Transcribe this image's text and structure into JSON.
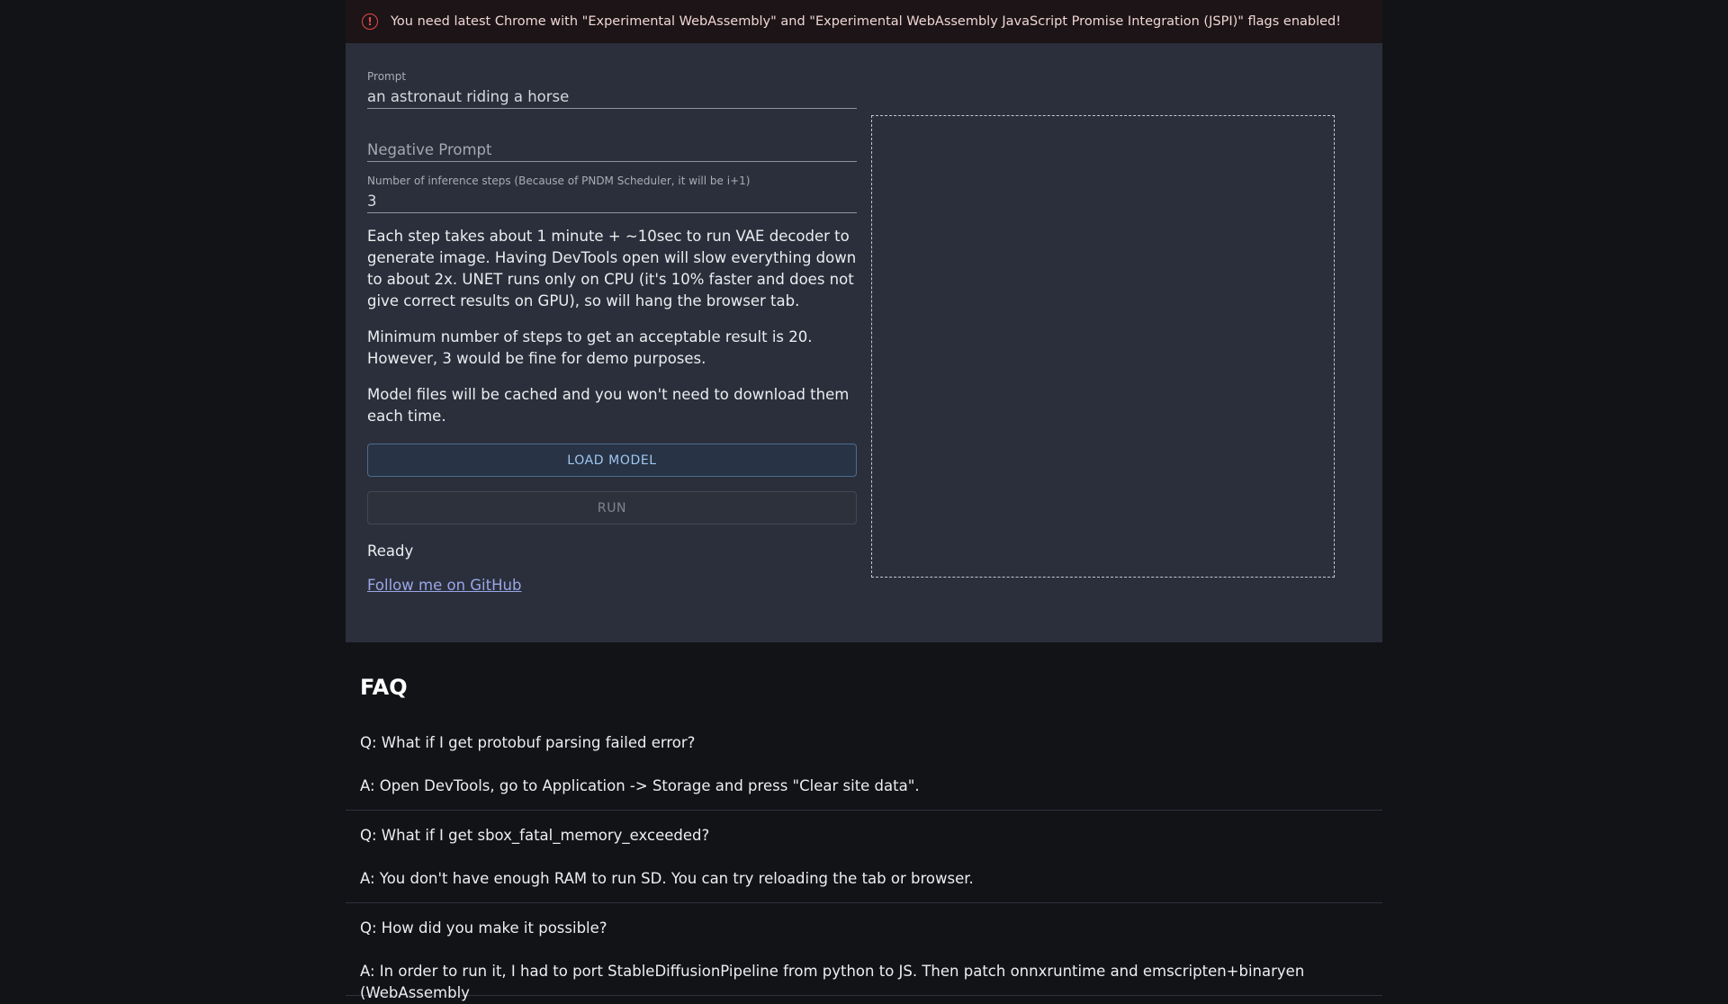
{
  "alert": {
    "icon": "error-icon",
    "text": "You need latest Chrome with \"Experimental WebAssembly\" and \"Experimental WebAssembly JavaScript Promise Integration (JSPI)\" flags enabled!"
  },
  "form": {
    "prompt": {
      "label": "Prompt",
      "value": "an astronaut riding a horse"
    },
    "negative_prompt": {
      "placeholder": "Negative Prompt",
      "value": ""
    },
    "steps": {
      "label": "Number of inference steps (Because of PNDM Scheduler, it will be i+1)",
      "value": "3"
    }
  },
  "descriptions": [
    "Each step takes about 1 minute + ~10sec to run VAE decoder to generate image. Having DevTools open will slow everything down to about 2x. UNET runs only on CPU (it's 10% faster and does not give correct results on GPU), so will hang the browser tab.",
    "Minimum number of steps to get an acceptable result is 20. However, 3 would be fine for demo purposes.",
    "Model files will be cached and you won't need to download them each time."
  ],
  "buttons": {
    "load_model": "LOAD MODEL",
    "run": "RUN"
  },
  "status": "Ready",
  "github_link": "Follow me on GitHub",
  "faq": {
    "title": "FAQ",
    "items": [
      {
        "q": "Q: What if I get protobuf parsing failed error?",
        "a": "A: Open DevTools, go to Application -> Storage and press \"Clear site data\"."
      },
      {
        "q": "Q: What if I get sbox_fatal_memory_exceeded?",
        "a": "A: You don't have enough RAM to run SD. You can try reloading the tab or browser."
      },
      {
        "q": "Q: How did you make it possible?",
        "a": "A: In order to run it, I had to port StableDiffusionPipeline from python to JS. Then patch onnxruntime and emscripten+binaryen (WebAssembly"
      }
    ]
  },
  "colors": {
    "background": "#121317",
    "card": "#2a2f3b",
    "accent": "#9fc7f0",
    "error": "#e5484d"
  }
}
